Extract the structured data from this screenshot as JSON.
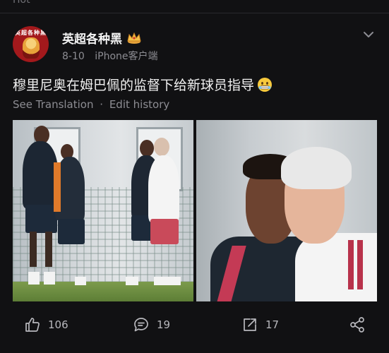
{
  "top": {
    "cut_text": "Hot"
  },
  "post": {
    "username": "英超各种黑",
    "avatar_text": "英超各种黑",
    "date": "8-10",
    "device": "iPhone客户端",
    "text": "穆里尼奥在姆巴佩的监督下给新球员指导",
    "see_translation": "See Translation",
    "separator": "·",
    "edit_history": "Edit history"
  },
  "actions": {
    "likes": "106",
    "comments": "19",
    "shares": "17"
  },
  "icons": {
    "crown": "crown-icon",
    "emoji": "grimacing-emoji-icon",
    "menu": "chevron-down-icon",
    "like": "thumbs-up-icon",
    "comment": "comment-icon",
    "share": "share-out-icon",
    "network": "share-network-icon"
  },
  "colors": {
    "background": "#111113",
    "muted_text": "#8d8d93",
    "avatar_red": "#a3191c"
  }
}
